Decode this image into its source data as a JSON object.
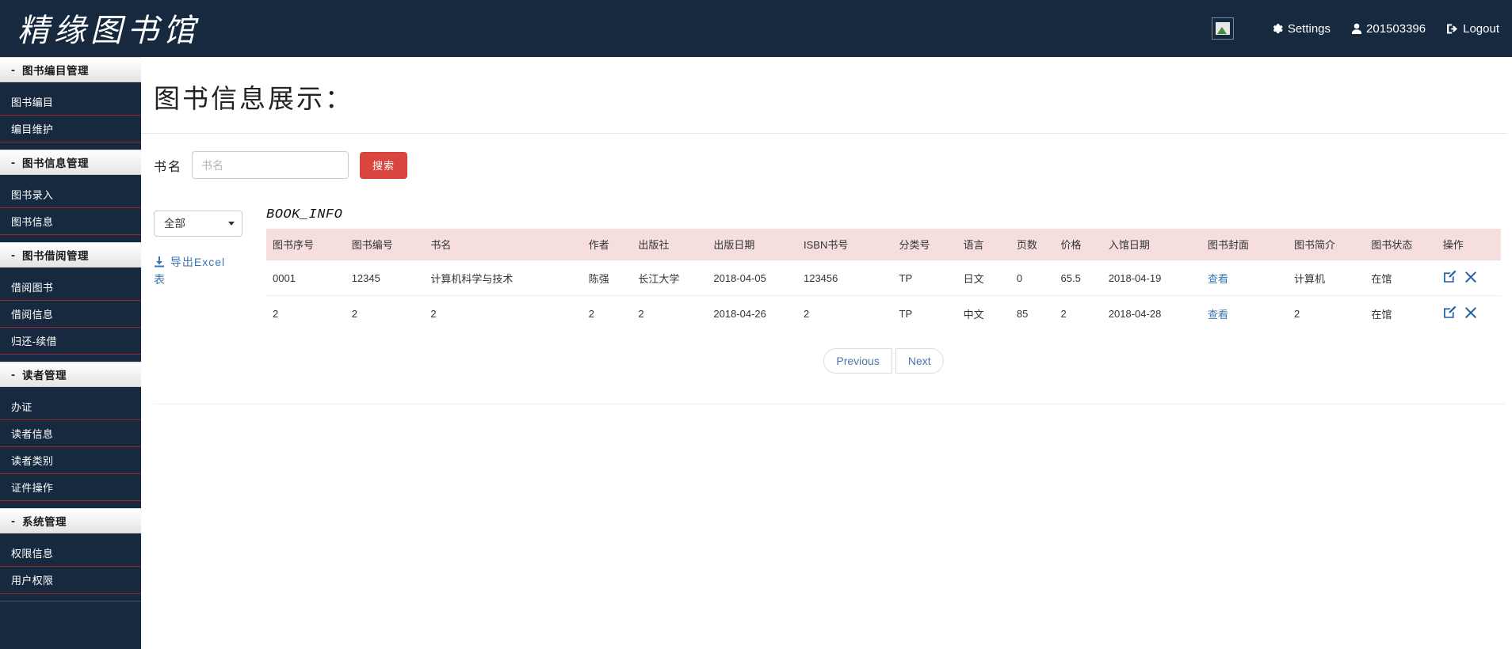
{
  "navbar": {
    "brand": "精缘图书馆",
    "image_icon": "broken-image-icon",
    "settings_label": "Settings",
    "user_label": "201503396",
    "logout_label": "Logout"
  },
  "sidebar": {
    "groups": [
      {
        "title": "图书编目管理",
        "collapse_sign": "-",
        "items": [
          {
            "label": "图书编目"
          },
          {
            "label": "编目维护"
          }
        ]
      },
      {
        "title": "图书信息管理",
        "collapse_sign": "-",
        "items": [
          {
            "label": "图书录入"
          },
          {
            "label": "图书信息"
          }
        ]
      },
      {
        "title": "图书借阅管理",
        "collapse_sign": "-",
        "items": [
          {
            "label": "借阅图书"
          },
          {
            "label": "借阅信息"
          },
          {
            "label": "归还-续借"
          }
        ]
      },
      {
        "title": "读者管理",
        "collapse_sign": "-",
        "items": [
          {
            "label": "办证"
          },
          {
            "label": "读者信息"
          },
          {
            "label": "读者类别"
          },
          {
            "label": "证件操作"
          }
        ]
      },
      {
        "title": "系统管理",
        "collapse_sign": "-",
        "items": [
          {
            "label": "权限信息"
          },
          {
            "label": "用户权限"
          }
        ]
      }
    ]
  },
  "main": {
    "page_title": "图书信息展示：",
    "search": {
      "label": "书名",
      "placeholder": "书名",
      "value": "",
      "button_label": "搜索"
    },
    "filter": {
      "selected": "全部",
      "options": [
        "全部"
      ]
    },
    "export_label": "导出Excel表",
    "table_caption": "BOOK_INFO",
    "columns": [
      "图书序号",
      "图书编号",
      "书名",
      "作者",
      "出版社",
      "出版日期",
      "ISBN书号",
      "分类号",
      "语言",
      "页数",
      "价格",
      "入馆日期",
      "图书封面",
      "图书简介",
      "图书状态",
      "操作"
    ],
    "rows": [
      {
        "序号": "0001",
        "编号": "12345",
        "书名": "计算机科学与技术",
        "作者": "陈强",
        "出版社": "长江大学",
        "出版日期": "2018-04-05",
        "ISBN": "123456",
        "分类号": "TP",
        "语言": "日文",
        "页数": "0",
        "价格": "65.5",
        "入馆日期": "2018-04-19",
        "封面": "查看",
        "简介": "计算机",
        "状态": "在馆"
      },
      {
        "序号": "2",
        "编号": "2",
        "书名": "2",
        "作者": "2",
        "出版社": "2",
        "出版日期": "2018-04-26",
        "ISBN": "2",
        "分类号": "TP",
        "语言": "中文",
        "页数": "85",
        "价格": "2",
        "入馆日期": "2018-04-28",
        "封面": "查看",
        "简介": "2",
        "状态": "在馆"
      }
    ],
    "pagination": {
      "previous_label": "Previous",
      "next_label": "Next"
    }
  },
  "colors": {
    "navy": "#16293f",
    "accent_red": "#d9453f",
    "table_header_pink": "#f6dede",
    "link_blue": "#3b75b5",
    "sidebar_divider_red": "#a31f27"
  }
}
